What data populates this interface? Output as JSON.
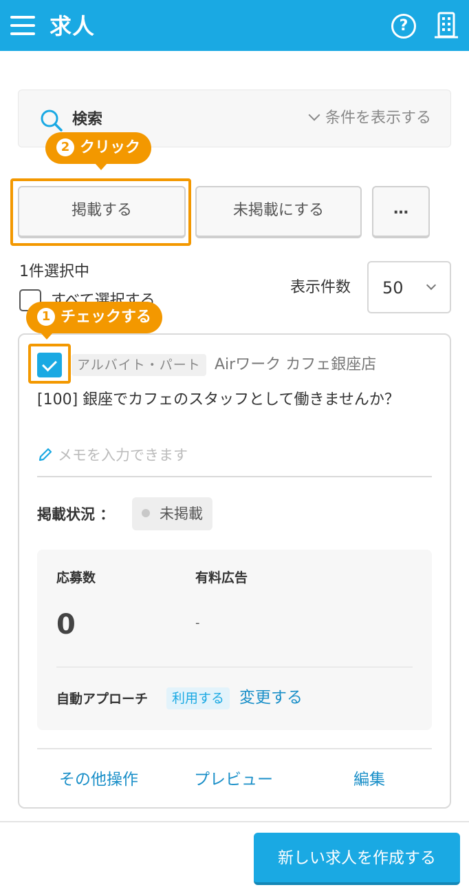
{
  "header": {
    "title": "求人",
    "menu_icon": "hamburger-menu-icon",
    "help_icon": "help-circle-icon",
    "help_glyph": "?",
    "store_icon": "building-icon"
  },
  "search": {
    "label": "検索",
    "conditions_toggle": "条件を表示する"
  },
  "tooltips": {
    "click": {
      "num": "2",
      "text": "クリック"
    },
    "check": {
      "num": "1",
      "text": "チェックする"
    }
  },
  "actions": {
    "publish": "掲載する",
    "unpublish": "未掲載にする",
    "more": "…"
  },
  "selection": {
    "count_text": "1件選択中",
    "select_all": "すべて選択する",
    "per_page_label": "表示件数",
    "per_page_value": "50"
  },
  "job": {
    "checked": true,
    "type_tag": "アルバイト・パート",
    "store": "Airワーク カフェ銀座店",
    "title": "[100] 銀座でカフェのスタッフとして働きませんか？",
    "memo_placeholder": "メモを入力できます",
    "status_label": "掲載状況 ：",
    "status": "未掲載",
    "stats": {
      "applications_label": "応募数",
      "applications_value": "0",
      "paid_ads_label": "有料広告",
      "paid_ads_value": "-",
      "auto_approach_label": "自動アプローチ",
      "auto_approach_status": "利用する",
      "change_link": "変更する"
    },
    "card_actions": {
      "other": "その他操作",
      "preview": "プレビュー",
      "edit": "編集"
    }
  },
  "footer": {
    "create_button": "新しい求人を作成する"
  },
  "colors": {
    "primary": "#1aa9e3",
    "highlight": "#f39800",
    "link": "#1a8fc8"
  }
}
